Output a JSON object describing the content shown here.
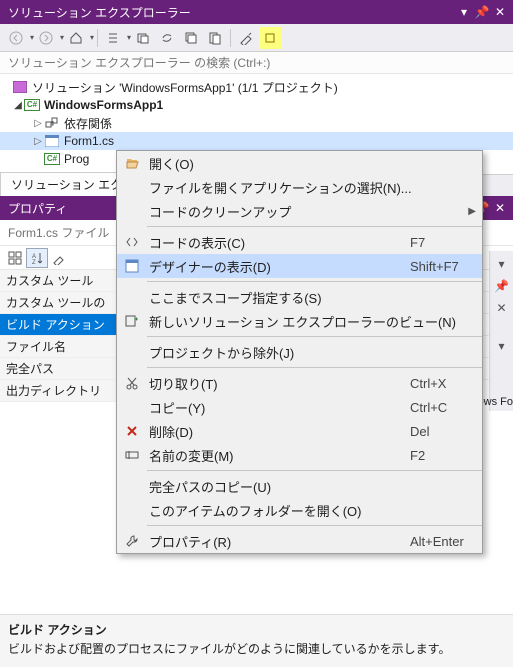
{
  "solutionExplorer": {
    "title": "ソリューション エクスプローラー",
    "search": {
      "placeholder": "ソリューション エクスプローラー の検索 (Ctrl+:)"
    },
    "tree": {
      "solution": "ソリューション 'WindowsFormsApp1' (1/1 プロジェクト)",
      "project": "WindowsFormsApp1",
      "deps": "依存関係",
      "form": "Form1.cs",
      "program": "Prog"
    },
    "tabLabel": "ソリューション エクス"
  },
  "propertiesPanel": {
    "title": "プロパティ",
    "header": "Form1.cs ファイル",
    "rows": [
      {
        "k": "カスタム ツール",
        "v": ""
      },
      {
        "k": "カスタム ツールの",
        "v": ""
      },
      {
        "k": "ビルド アクション",
        "v": ""
      },
      {
        "k": "ファイル名",
        "v": ""
      },
      {
        "k": "完全パス",
        "v": ""
      },
      {
        "k": "出力ディレクトリ",
        "v": ""
      }
    ],
    "focusRow": 2,
    "desc": {
      "title": "ビルド アクション",
      "body": "ビルドおよび配置のプロセスにファイルがどのように関連しているかを示します。"
    },
    "rightStripHint": "ows Fo"
  },
  "contextMenu": {
    "highlightedIndex": 5,
    "items": [
      {
        "icon": "open",
        "label": "開く(O)"
      },
      {
        "icon": null,
        "label": "ファイルを開くアプリケーションの選択(N)..."
      },
      {
        "icon": null,
        "label": "コードのクリーンアップ",
        "submenu": true
      },
      {
        "sep": true
      },
      {
        "icon": "code",
        "label": "コードの表示(C)",
        "shortcut": "F7"
      },
      {
        "icon": "design",
        "label": "デザイナーの表示(D)",
        "shortcut": "Shift+F7"
      },
      {
        "sep": true
      },
      {
        "icon": null,
        "label": "ここまでスコープ指定する(S)"
      },
      {
        "icon": "newview",
        "label": "新しいソリューション エクスプローラーのビュー(N)"
      },
      {
        "sep": true
      },
      {
        "icon": null,
        "label": "プロジェクトから除外(J)"
      },
      {
        "sep": true
      },
      {
        "icon": "cut",
        "label": "切り取り(T)",
        "shortcut": "Ctrl+X"
      },
      {
        "icon": null,
        "label": "コピー(Y)",
        "shortcut": "Ctrl+C"
      },
      {
        "icon": "delete",
        "label": "削除(D)",
        "shortcut": "Del"
      },
      {
        "icon": "rename",
        "label": "名前の変更(M)",
        "shortcut": "F2"
      },
      {
        "sep": true
      },
      {
        "icon": null,
        "label": "完全パスのコピー(U)"
      },
      {
        "icon": null,
        "label": "このアイテムのフォルダーを開く(O)"
      },
      {
        "sep": true
      },
      {
        "icon": "wrench",
        "label": "プロパティ(R)",
        "shortcut": "Alt+Enter"
      }
    ]
  }
}
